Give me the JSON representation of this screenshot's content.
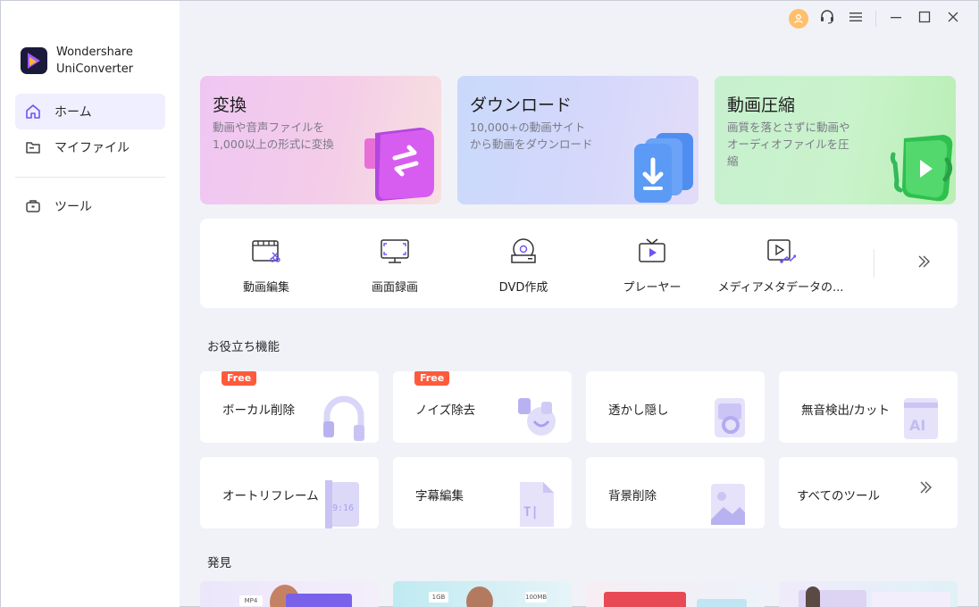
{
  "app": {
    "name_line1": "Wondershare",
    "name_line2": "UniConverter"
  },
  "sidebar": {
    "items": [
      {
        "label": "ホーム",
        "icon": "home-icon",
        "active": true
      },
      {
        "label": "マイファイル",
        "icon": "folder-icon",
        "active": false
      },
      {
        "label": "ツール",
        "icon": "toolbox-icon",
        "active": false
      }
    ]
  },
  "titlebar": {
    "icons": [
      "user-avatar-icon",
      "headset-icon",
      "menu-icon",
      "minimize-icon",
      "maximize-icon",
      "close-icon"
    ]
  },
  "hero_cards": [
    {
      "title": "変換",
      "desc": "動画や音声ファイルを1,000以上の形式に変換",
      "icon": "convert-icon"
    },
    {
      "title": "ダウンロード",
      "desc": "10,000+の動画サイトから動画をダウンロード",
      "icon": "download-icon"
    },
    {
      "title": "動画圧縮",
      "desc": "画質を落とさずに動画やオーディオファイルを圧縮",
      "icon": "compress-icon"
    }
  ],
  "quick_tools": [
    {
      "label": "動画編集",
      "icon": "video-edit-icon"
    },
    {
      "label": "画面録画",
      "icon": "screen-record-icon"
    },
    {
      "label": "DVD作成",
      "icon": "dvd-burn-icon"
    },
    {
      "label": "プレーヤー",
      "icon": "player-icon"
    },
    {
      "label": "メディアメタデータの...",
      "icon": "metadata-icon"
    }
  ],
  "sections": {
    "useful": "お役立ち機能",
    "discover": "発見"
  },
  "tools": [
    {
      "label": "ボーカル削除",
      "badge": "Free",
      "icon": "vocal-remover-icon"
    },
    {
      "label": "ノイズ除去",
      "badge": "Free",
      "icon": "noise-remover-icon"
    },
    {
      "label": "透かし隠し",
      "badge": "",
      "icon": "watermark-icon"
    },
    {
      "label": "無音検出/カット",
      "badge": "",
      "icon": "ai-silence-icon"
    },
    {
      "label": "オートリフレーム",
      "badge": "",
      "icon": "auto-reframe-icon",
      "art_text": "9:16"
    },
    {
      "label": "字幕編集",
      "badge": "",
      "icon": "subtitle-icon",
      "art_text": "T|"
    },
    {
      "label": "背景削除",
      "badge": "",
      "icon": "background-remover-icon"
    },
    {
      "label": "すべてのツール",
      "badge": "",
      "icon": "double-chevron-icon"
    }
  ],
  "discover_cards": [
    {
      "tag": "MP4"
    },
    {
      "tag": "1GB",
      "tag2": "100MB"
    },
    {
      "tag": ""
    },
    {
      "tag": ""
    }
  ]
}
